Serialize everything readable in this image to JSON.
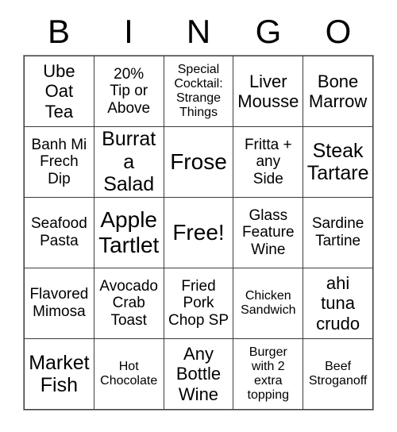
{
  "card": {
    "header_letters": [
      "B",
      "I",
      "N",
      "G",
      "O"
    ],
    "rows": [
      [
        {
          "text": "Ube\nOat\nTea",
          "size": "lg"
        },
        {
          "text": "20%\nTip or\nAbove",
          "size": "md"
        },
        {
          "text": "Special\nCocktail:\nStrange\nThings",
          "size": "sm"
        },
        {
          "text": "Liver\nMousse",
          "size": "lg"
        },
        {
          "text": "Bone\nMarrow",
          "size": "lg"
        }
      ],
      [
        {
          "text": "Banh Mi\nFrech\nDip",
          "size": "md"
        },
        {
          "text": "Burrata\nSalad",
          "size": "xl"
        },
        {
          "text": "Frose",
          "size": "xxl"
        },
        {
          "text": "Fritta +\nany\nSide",
          "size": "md"
        },
        {
          "text": "Steak\nTartare",
          "size": "xl"
        }
      ],
      [
        {
          "text": "Seafood\nPasta",
          "size": "md"
        },
        {
          "text": "Apple\nTartlet",
          "size": "xxl"
        },
        {
          "text": "Free!",
          "size": "xxl"
        },
        {
          "text": "Glass\nFeature\nWine",
          "size": "md"
        },
        {
          "text": "Sardine\nTartine",
          "size": "md"
        }
      ],
      [
        {
          "text": "Flavored\nMimosa",
          "size": "md"
        },
        {
          "text": "Avocado\nCrab\nToast",
          "size": "md"
        },
        {
          "text": "Fried\nPork\nChop SP",
          "size": "md"
        },
        {
          "text": "Chicken\nSandwich",
          "size": "sm"
        },
        {
          "text": "ahi\ntuna\ncrudo",
          "size": "lg"
        }
      ],
      [
        {
          "text": "Market\nFish",
          "size": "xl"
        },
        {
          "text": "Hot\nChocolate",
          "size": "sm"
        },
        {
          "text": "Any\nBottle\nWine",
          "size": "lg"
        },
        {
          "text": "Burger\nwith 2\nextra\ntopping",
          "size": "sm"
        },
        {
          "text": "Beef\nStroganoff",
          "size": "sm"
        }
      ]
    ],
    "colors": {
      "background": "#ffffff",
      "text": "#000000",
      "grid_line": "#3c3c3c",
      "outer_frame": "#9a9a9a"
    }
  }
}
